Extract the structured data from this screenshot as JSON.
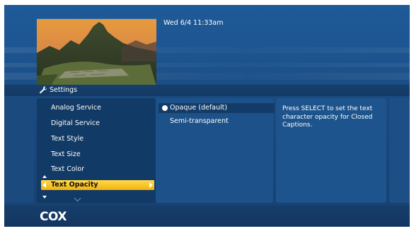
{
  "header": {
    "datetime": "Wed 6/4  11:33am",
    "section_title": "Settings"
  },
  "menu": {
    "items": [
      {
        "label": "Analog Service",
        "selected": false
      },
      {
        "label": "Digital Service",
        "selected": false
      },
      {
        "label": "Text Style",
        "selected": false
      },
      {
        "label": "Text Size",
        "selected": false
      },
      {
        "label": "Text Color",
        "selected": false
      },
      {
        "label": "Text Opacity",
        "selected": true
      }
    ]
  },
  "options": {
    "items": [
      {
        "label": "Opaque (default)",
        "checked": true
      },
      {
        "label": "Semi-transparent",
        "checked": false
      }
    ]
  },
  "help": {
    "text": "Press SELECT to set the text character opacity for Closed Captions."
  },
  "footer": {
    "logo_text": "COX"
  },
  "colors": {
    "background": "#1c4f86",
    "selection": "#f5bd1c",
    "menu_panel": "#123a66",
    "text": "#ffffff"
  },
  "icons": {
    "settings": "wrench-icon",
    "scroll_up": "triangle-up-icon",
    "scroll_down": "triangle-down-icon",
    "more_below": "chevron-down-icon",
    "selected_option": "radio-dot-icon"
  }
}
